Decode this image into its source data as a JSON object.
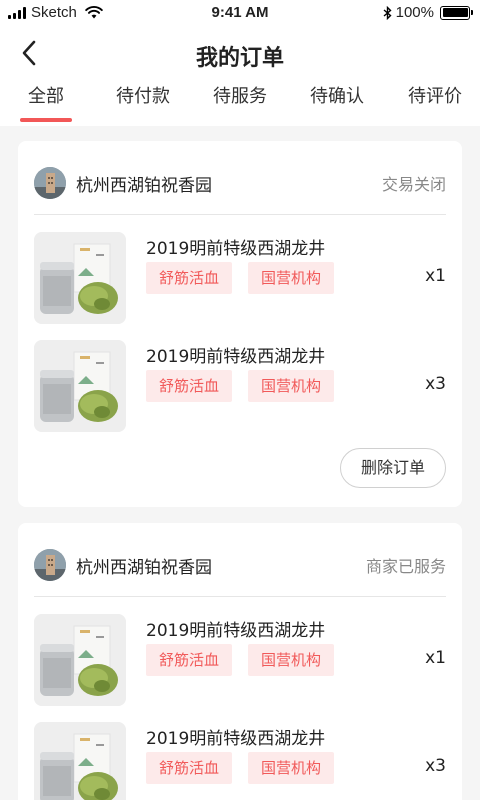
{
  "status_bar": {
    "carrier": "Sketch",
    "time": "9:41 AM",
    "battery": "100%"
  },
  "nav": {
    "title": "我的订单",
    "back_icon": "chevron-left-icon"
  },
  "tabs": [
    {
      "label": "全部",
      "active": true
    },
    {
      "label": "待付款",
      "active": false
    },
    {
      "label": "待服务",
      "active": false
    },
    {
      "label": "待确认",
      "active": false
    },
    {
      "label": "待评价",
      "active": false
    }
  ],
  "colors": {
    "accent": "#f25757",
    "tag_bg": "#fdeaea",
    "tag_text": "#f15a5a",
    "page_bg": "#f5f5f5"
  },
  "orders": [
    {
      "shop_name": "杭州西湖铂祝香园",
      "status": "交易关闭",
      "items": [
        {
          "name": "2019明前特级西湖龙井",
          "tags": [
            "舒筋活血",
            "国营机构"
          ],
          "qty": "x1"
        },
        {
          "name": "2019明前特级西湖龙井",
          "tags": [
            "舒筋活血",
            "国营机构"
          ],
          "qty": "x3"
        }
      ],
      "action_label": "删除订单"
    },
    {
      "shop_name": "杭州西湖铂祝香园",
      "status": "商家已服务",
      "items": [
        {
          "name": "2019明前特级西湖龙井",
          "tags": [
            "舒筋活血",
            "国营机构"
          ],
          "qty": "x1"
        },
        {
          "name": "2019明前特级西湖龙井",
          "tags": [
            "舒筋活血",
            "国营机构"
          ],
          "qty": "x3"
        }
      ]
    }
  ]
}
